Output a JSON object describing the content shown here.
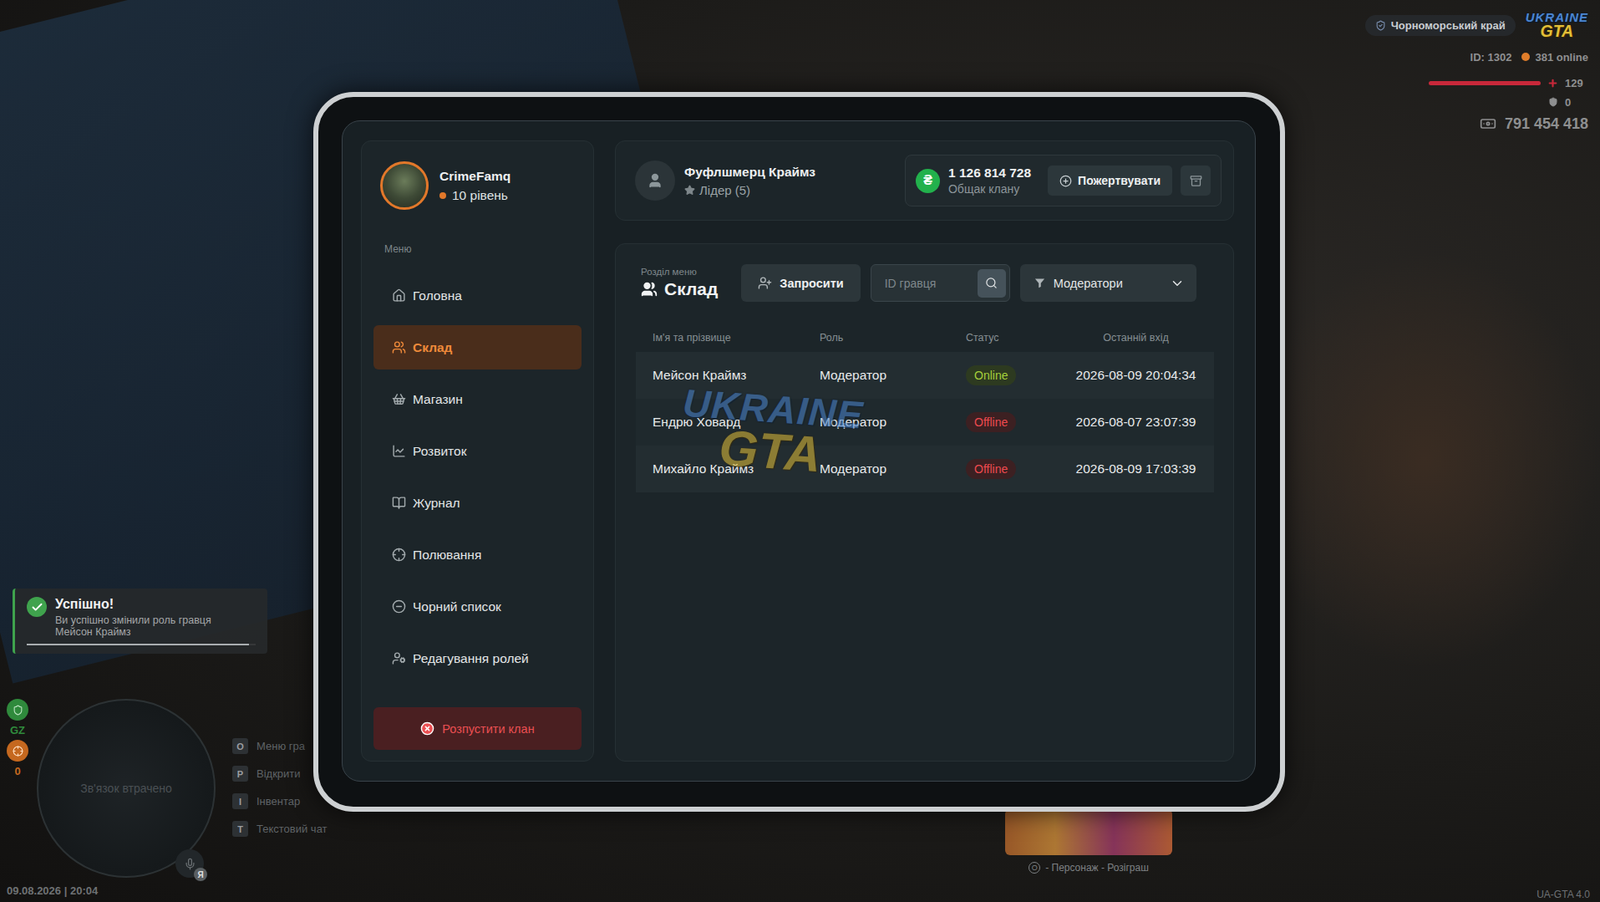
{
  "hud": {
    "region": "Чорноморський край",
    "logo": {
      "top": "UKRAINE",
      "bottom": "GTA"
    },
    "player_id": "ID: 1302",
    "online": "381 online",
    "health": {
      "value": "129",
      "level": 1
    },
    "armor": {
      "value": "0"
    },
    "money": "791 454 418"
  },
  "notification": {
    "title": "Успішно!",
    "message": "Ви успішно змінили роль гравця Мейсон Краймз",
    "level": 0.97
  },
  "minimap": {
    "status": "Зв'язок втрачено",
    "zone": "GZ",
    "wanted": "0",
    "voice_key": "Я"
  },
  "keybinds": [
    {
      "key": "O",
      "label": "Меню гра"
    },
    {
      "key": "P",
      "label": "Відкрити"
    },
    {
      "key": "I",
      "label": "Інвентар"
    },
    {
      "key": "T",
      "label": "Текстовий чат"
    }
  ],
  "datetime": "09.08.2026 | 20:04",
  "version": "UA-GTA 4.0",
  "promo": {
    "key": "O",
    "label": "- Персонаж - Розіграш"
  },
  "tablet": {
    "clan": {
      "name": "CrimeFamq",
      "level": "10 рівень"
    },
    "menu_label": "Меню",
    "menu": [
      {
        "label": "Головна",
        "selected": false
      },
      {
        "label": "Склад",
        "selected": true
      },
      {
        "label": "Магазин",
        "selected": false
      },
      {
        "label": "Розвиток",
        "selected": false
      },
      {
        "label": "Журнал",
        "selected": false
      },
      {
        "label": "Полювання",
        "selected": false
      },
      {
        "label": "Чорний список",
        "selected": false
      },
      {
        "label": "Редагування ролей",
        "selected": false
      }
    ],
    "disband_button": "Розпустити клан",
    "leader": {
      "name": "Фуфлшмерц Краймз",
      "role": "Лідер (5)"
    },
    "treasury": {
      "currency": "₴",
      "amount": "1 126 814 728",
      "label": "Общак клану"
    },
    "donate_button": "Пожертвувати",
    "section": {
      "caption": "Розділ меню",
      "title": "Склад"
    },
    "invite_button": "Запросити",
    "search": {
      "placeholder": "ID гравця"
    },
    "filter": {
      "value": "Модератори"
    },
    "table": {
      "columns": [
        "Ім'я та прізвище",
        "Роль",
        "Статус",
        "Останній вхід"
      ],
      "rows": [
        {
          "name": "Мейсон Краймз",
          "role": "Модератор",
          "status": "Online",
          "online": true,
          "last_login": "2026-08-09 20:04:34"
        },
        {
          "name": "Ендрю Ховард",
          "role": "Модератор",
          "status": "Offline",
          "online": false,
          "last_login": "2026-08-07 23:07:39"
        },
        {
          "name": "Михайло Краймз",
          "role": "Модератор",
          "status": "Offline",
          "online": false,
          "last_login": "2026-08-09 17:03:39"
        }
      ]
    },
    "watermark": {
      "top": "UKRAINE",
      "bottom": "GTA"
    }
  }
}
